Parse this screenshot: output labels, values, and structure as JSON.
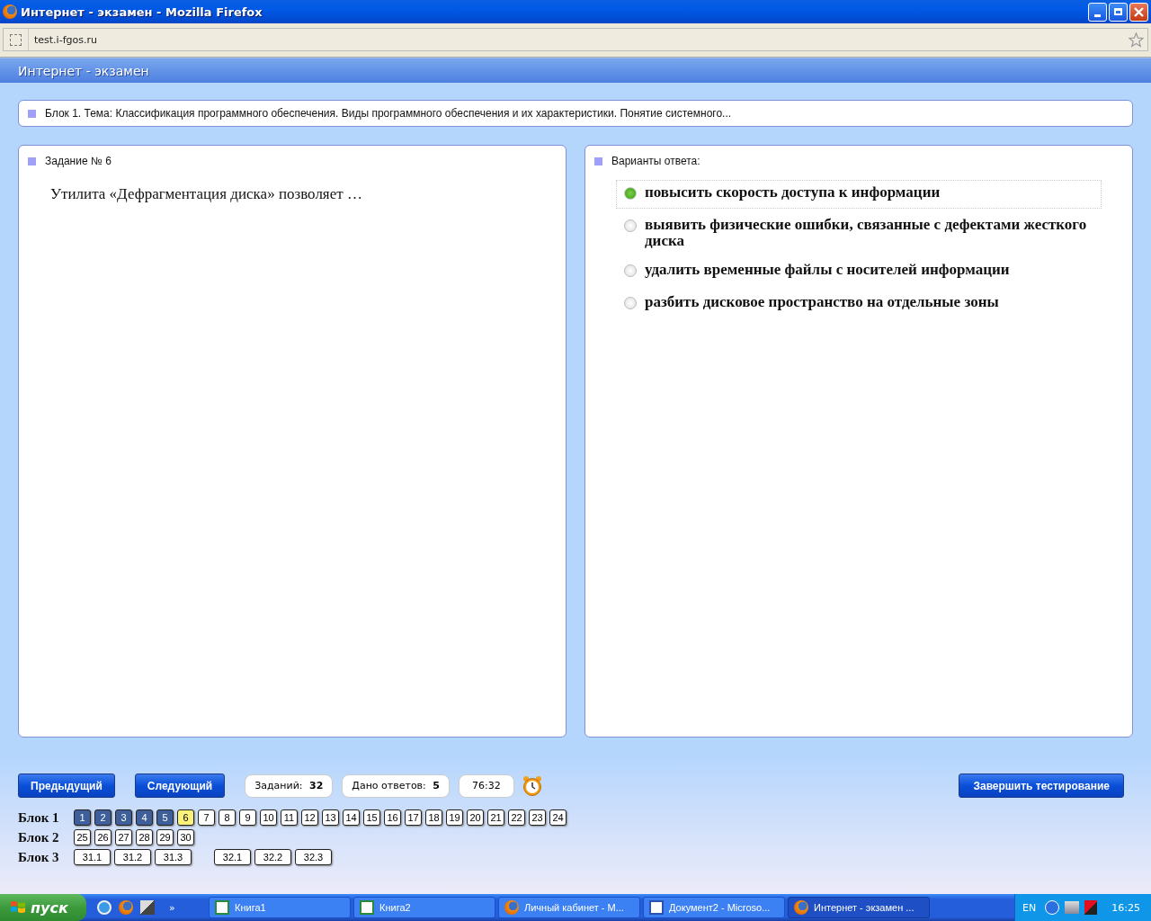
{
  "window": {
    "title": "Интернет - экзамен - Mozilla Firefox"
  },
  "address_bar": {
    "url": "test.i-fgos.ru"
  },
  "page_header": {
    "title": "Интернет - экзамен"
  },
  "topic": {
    "text": "Блок 1. Тема: Классификация программного обеспечения. Виды программного обеспечения и их характеристики. Понятие системного..."
  },
  "task_panel": {
    "heading": "Задание № 6",
    "question": "Утилита «Дефрагментация диска» позволяет …"
  },
  "answers_panel": {
    "heading": "Варианты ответа:",
    "options": [
      {
        "text": "повысить скорость доступа к информации",
        "selected": true
      },
      {
        "text": "выявить физические ошибки, связанные с дефектами жесткого диска",
        "selected": false
      },
      {
        "text": "удалить временные файлы с носителей информации",
        "selected": false
      },
      {
        "text": "разбить дисковое пространство на отдельные зоны",
        "selected": false
      }
    ]
  },
  "nav": {
    "prev": "Предыдущий",
    "next": "Следующий",
    "tasks_label": "Заданий:",
    "tasks_count": "32",
    "answers_label": "Дано ответов:",
    "answers_count": "5",
    "timer": "76:32",
    "finish": "Завершить тестирование"
  },
  "blocks": [
    {
      "label": "Блок 1",
      "groups": [
        [
          {
            "label": "1",
            "answered": true,
            "selected": false
          },
          {
            "label": "2",
            "answered": true,
            "selected": false
          },
          {
            "label": "3",
            "answered": true,
            "selected": false
          },
          {
            "label": "4",
            "answered": true,
            "selected": false
          },
          {
            "label": "5",
            "answered": true,
            "selected": false
          },
          {
            "label": "6",
            "answered": false,
            "selected": true
          },
          {
            "label": "7",
            "answered": false,
            "selected": false
          },
          {
            "label": "8",
            "answered": false,
            "selected": false
          },
          {
            "label": "9",
            "answered": false,
            "selected": false
          },
          {
            "label": "10",
            "answered": false,
            "selected": false
          },
          {
            "label": "11",
            "answered": false,
            "selected": false
          },
          {
            "label": "12",
            "answered": false,
            "selected": false
          },
          {
            "label": "13",
            "answered": false,
            "selected": false
          },
          {
            "label": "14",
            "answered": false,
            "selected": false
          },
          {
            "label": "15",
            "answered": false,
            "selected": false
          },
          {
            "label": "16",
            "answered": false,
            "selected": false
          },
          {
            "label": "17",
            "answered": false,
            "selected": false
          },
          {
            "label": "18",
            "answered": false,
            "selected": false
          },
          {
            "label": "19",
            "answered": false,
            "selected": false
          },
          {
            "label": "20",
            "answered": false,
            "selected": false
          },
          {
            "label": "21",
            "answered": false,
            "selected": false
          },
          {
            "label": "22",
            "answered": false,
            "selected": false
          },
          {
            "label": "23",
            "answered": false,
            "selected": false
          },
          {
            "label": "24",
            "answered": false,
            "selected": false
          }
        ]
      ]
    },
    {
      "label": "Блок 2",
      "groups": [
        [
          {
            "label": "25",
            "answered": false,
            "selected": false
          },
          {
            "label": "26",
            "answered": false,
            "selected": false
          },
          {
            "label": "27",
            "answered": false,
            "selected": false
          },
          {
            "label": "28",
            "answered": false,
            "selected": false
          },
          {
            "label": "29",
            "answered": false,
            "selected": false
          },
          {
            "label": "30",
            "answered": false,
            "selected": false
          }
        ]
      ]
    },
    {
      "label": "Блок 3",
      "groups": [
        [
          {
            "label": "31.1",
            "answered": false,
            "selected": false
          },
          {
            "label": "31.2",
            "answered": false,
            "selected": false
          },
          {
            "label": "31.3",
            "answered": false,
            "selected": false
          }
        ],
        [
          {
            "label": "32.1",
            "answered": false,
            "selected": false
          },
          {
            "label": "32.2",
            "answered": false,
            "selected": false
          },
          {
            "label": "32.3",
            "answered": false,
            "selected": false
          }
        ]
      ]
    }
  ],
  "taskbar": {
    "start": "пуск",
    "more": "»",
    "tasks": [
      {
        "label": "Книга1",
        "kind": "excel",
        "selected": false
      },
      {
        "label": "Книга2",
        "kind": "excel",
        "selected": false
      },
      {
        "label": "Личный кабинет - М...",
        "kind": "firefox",
        "selected": false
      },
      {
        "label": "Документ2 - Microso...",
        "kind": "word",
        "selected": false
      },
      {
        "label": "Интернет - экзамен ...",
        "kind": "firefox",
        "selected": true
      }
    ],
    "language": "EN",
    "clock": "16:25"
  }
}
